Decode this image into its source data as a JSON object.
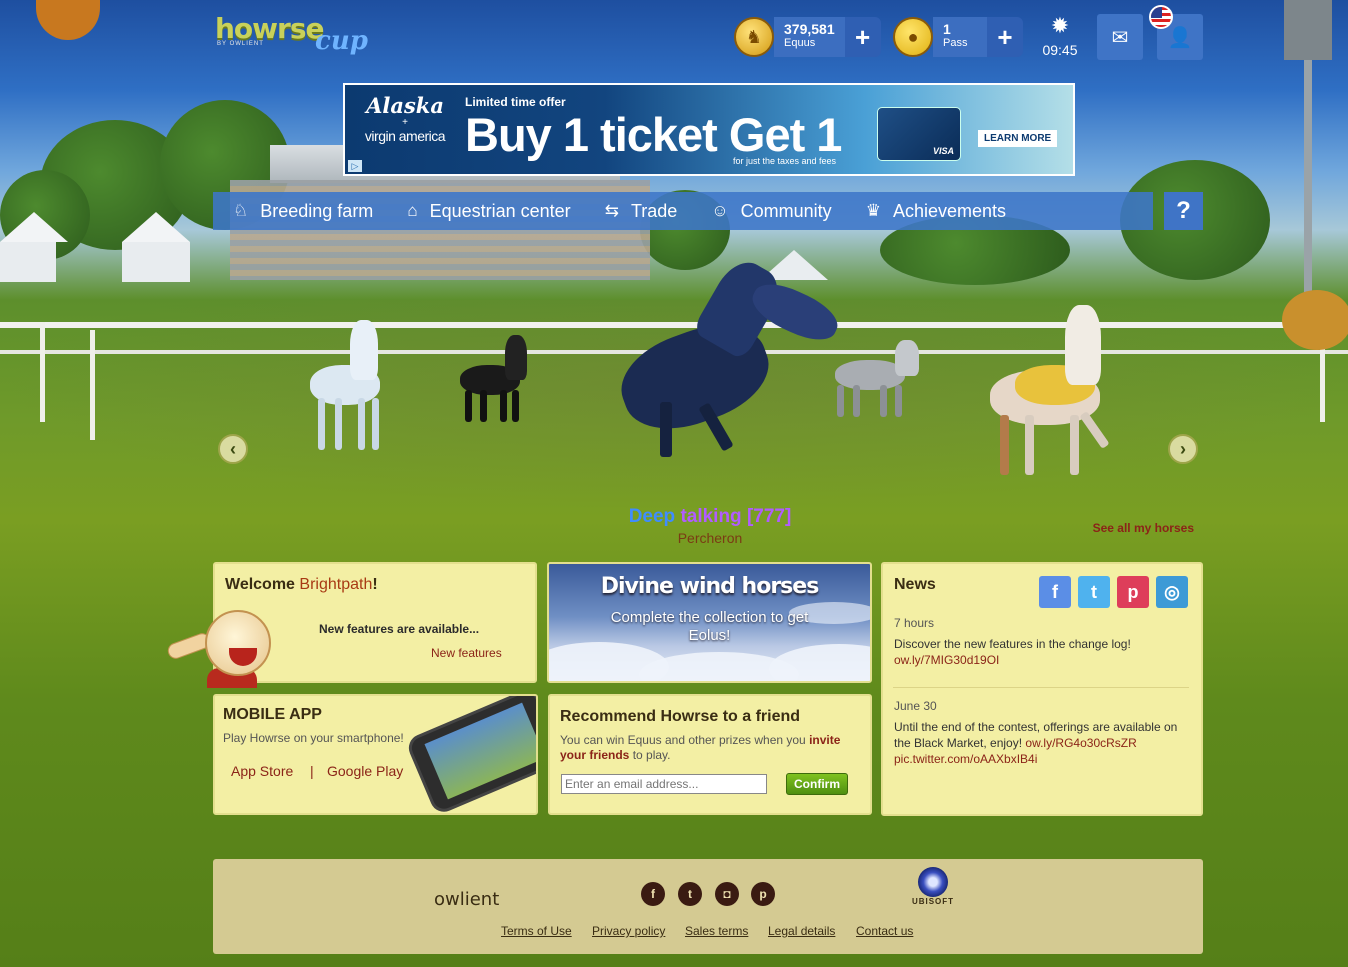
{
  "header": {
    "logo_main": "howrse",
    "logo_sub": "cup",
    "logo_by": "BY OWLIENT",
    "equus": {
      "value": "379,581",
      "label": "Equus"
    },
    "pass": {
      "value": "1",
      "label": "Pass"
    },
    "time": "09:45"
  },
  "ad": {
    "brand1": "Alaska",
    "brand_plus": "+",
    "brand2": "virgin america",
    "offer": "Limited time offer",
    "headline": "Buy 1 ticket Get 1",
    "fine": "for just the taxes and fees",
    "card": "VISA",
    "cta": "LEARN MORE"
  },
  "nav": {
    "items": [
      {
        "label": "Breeding farm",
        "icon": "horse-head-icon"
      },
      {
        "label": "Equestrian center",
        "icon": "stable-icon"
      },
      {
        "label": "Trade",
        "icon": "trade-icon"
      },
      {
        "label": "Community",
        "icon": "community-icon"
      },
      {
        "label": "Achievements",
        "icon": "trophy-icon"
      }
    ],
    "help": "?"
  },
  "showcase": {
    "name_part1": "Deep",
    "name_part2": "talking",
    "name_part3": "[777]",
    "breed": "Percheron",
    "see_all": "See all my horses"
  },
  "welcome": {
    "title": "Welcome",
    "name": "Brightpath",
    "exclaim": "!",
    "text": "New features are available...",
    "link": "New features"
  },
  "divine": {
    "title": "Divine wind horses",
    "subtitle": "Complete the collection to get Eolus!"
  },
  "news": {
    "title": "News",
    "items": [
      {
        "time": "7 hours",
        "text": "Discover the new features in the change log!",
        "link": "ow.ly/7MIG30d19OI"
      },
      {
        "time": "June 30",
        "text": "Until the end of the contest, offerings are available on the Black Market, enjoy!",
        "link1": "ow.ly/RG4o30cRsZR",
        "link2": "pic.twitter.com/oAAXbxIB4i"
      }
    ]
  },
  "mobile": {
    "title": "MOBILE APP",
    "subtitle": "Play Howrse on your smartphone!",
    "app_store": "App Store",
    "separator": "|",
    "google_play": "Google Play"
  },
  "recommend": {
    "title": "Recommend Howrse to a friend",
    "text1": "You can win Equus and other prizes when you",
    "text_bold": "invite your friends",
    "text2": "to play.",
    "placeholder": "Enter an email address...",
    "confirm": "Confirm"
  },
  "footer": {
    "owlient": "owlient",
    "ubisoft": "UBISOFT",
    "links": [
      "Terms of Use",
      "Privacy policy",
      "Sales terms",
      "Legal details",
      "Contact us"
    ]
  },
  "colors": {
    "nav_bg": "#3e76c8",
    "panel_bg": "#f3efa4",
    "link_red": "#8b2418",
    "confirm_green": "#5a9e14"
  }
}
